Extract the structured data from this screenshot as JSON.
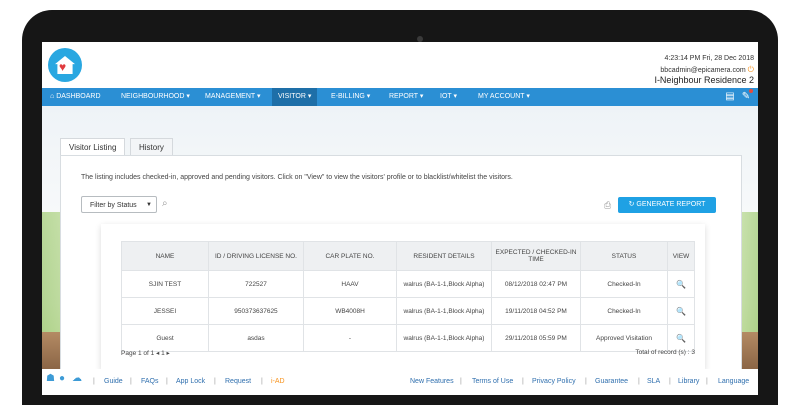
{
  "header": {
    "clock": "4:23:14 PM  Fri, 28 Dec 2018",
    "user": "bbcadmin@epicamera.com",
    "residence": "I-Neighbour Residence 2"
  },
  "nav": {
    "items": [
      {
        "label": "DASHBOARD"
      },
      {
        "label": "NEIGHBOURHOOD ▾"
      },
      {
        "label": "MANAGEMENT ▾"
      },
      {
        "label": "VISITOR ▾"
      },
      {
        "label": "E-BILLING ▾"
      },
      {
        "label": "REPORT ▾"
      },
      {
        "label": "IOT ▾"
      },
      {
        "label": "MY ACCOUNT ▾"
      }
    ],
    "active": "VISITOR"
  },
  "tabs": [
    {
      "label": "Visitor Listing"
    },
    {
      "label": "History"
    }
  ],
  "description": "The listing includes checked-in, approved and pending visitors. Click on \"View\" to view the visitors' profile or to blacklist/whitelist the visitors.",
  "filter": {
    "label": "Filter by Status"
  },
  "generate_report": "GENERATE REPORT",
  "table": {
    "headers": [
      "NAME",
      "ID / DRIVING LICENSE NO.",
      "CAR PLATE NO.",
      "RESIDENT DETAILS",
      "EXPECTED / CHECKED-IN TIME",
      "STATUS",
      "VIEW"
    ],
    "rows": [
      {
        "name": "SJIN TEST",
        "id": "722527",
        "plate": "HAAV",
        "resident": "walrus (BA-1-1,Block Alpha)",
        "time": "08/12/2018 02:47 PM",
        "status": "Checked-In"
      },
      {
        "name": "JESSEI",
        "id": "950373637625",
        "plate": "WB4008H",
        "resident": "walrus (BA-1-1,Block Alpha)",
        "time": "19/11/2018 04:52 PM",
        "status": "Checked-In"
      },
      {
        "name": "Guest",
        "id": "asdas",
        "plate": "-",
        "resident": "walrus (BA-1-1,Block Alpha)",
        "time": "29/11/2018 05:59 PM",
        "status": "Approved Visitation"
      }
    ]
  },
  "pager": "Page 1 of 1   ◂  1  ▸",
  "total": "Total of record (s) : 3",
  "footer": {
    "left_links": [
      "Guide",
      "FAQs",
      "App Lock",
      "Request",
      "i-AD"
    ],
    "right_links": [
      "New Features",
      "Terms of Use",
      "Privacy Policy",
      "Guarantee",
      "SLA",
      "Library",
      "Language"
    ]
  },
  "colors": {
    "nav": "#2b8fd4",
    "nav_active": "#1e6fa8",
    "accent": "#1fa1e4",
    "iad": "#f7931e"
  }
}
